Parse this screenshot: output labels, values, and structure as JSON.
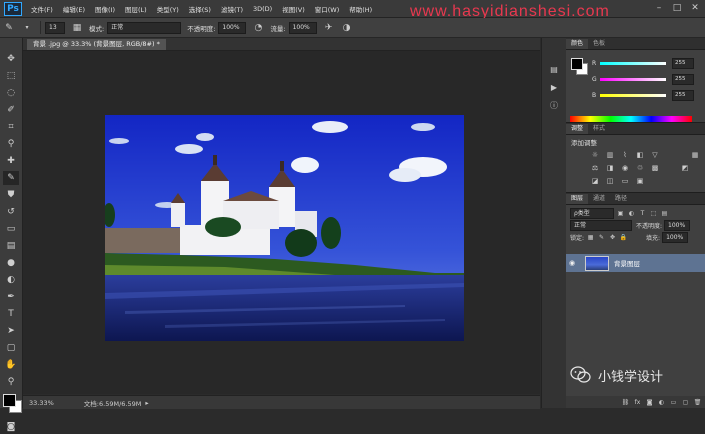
{
  "app": {
    "logo": "Ps"
  },
  "menu": [
    "文件(F)",
    "编辑(E)",
    "图像(I)",
    "图层(L)",
    "类型(Y)",
    "选择(S)",
    "滤镜(T)",
    "3D(D)",
    "视图(V)",
    "窗口(W)",
    "帮助(H)"
  ],
  "watermark": "www.hasyidianshesi.com",
  "options": {
    "brush_size": "13",
    "mode_label": "模式:",
    "mode_value": "正常",
    "opacity_label": "不透明度:",
    "opacity_value": "100%",
    "flow_label": "流量:",
    "flow_value": "100%"
  },
  "document_tab": "背景 .jpg @ 33.3% (背景图层, RGB/8#) *",
  "status": {
    "zoom": "33.33%",
    "doc": "文档:6.59M/6.59M"
  },
  "color_panel": {
    "tabs": [
      "颜色",
      "色板"
    ],
    "r_label": "R",
    "r_value": "255",
    "g_label": "G",
    "g_value": "255",
    "b_label": "B",
    "b_value": "255"
  },
  "adjust_panel": {
    "tabs": [
      "调整",
      "样式"
    ],
    "title": "添加调整"
  },
  "layers_panel": {
    "tabs": [
      "图层",
      "通道",
      "路径"
    ],
    "filter_label": "ρ类型",
    "blend_mode": "正常",
    "opacity_label": "不透明度:",
    "opacity_value": "100%",
    "lock_label": "锁定:",
    "fill_label": "填充:",
    "fill_value": "100%",
    "layer_name": "背景图层"
  },
  "wechat_text": "小钱学设计",
  "colors": {
    "accent": "#31a8ff",
    "selected_layer": "#5e7392",
    "watermark": "#e8384f"
  }
}
